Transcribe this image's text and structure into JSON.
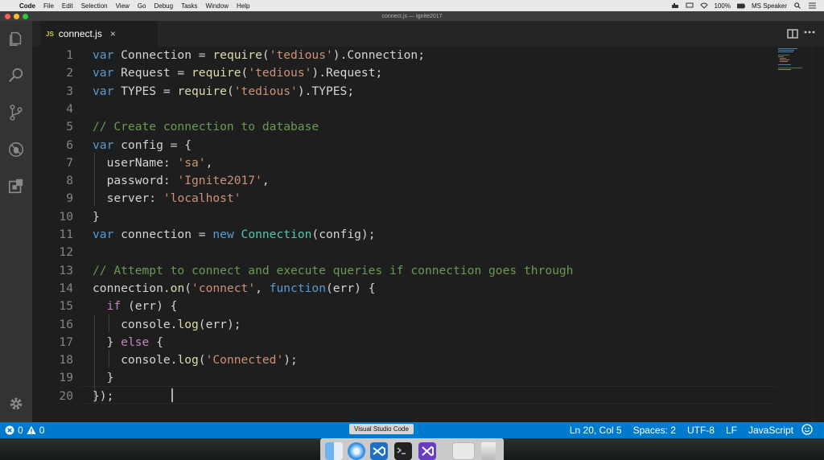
{
  "menubar": {
    "app_name": "Code",
    "items": [
      "File",
      "Edit",
      "Selection",
      "View",
      "Go",
      "Debug",
      "Tasks",
      "Window",
      "Help"
    ],
    "battery": "100%",
    "user": "MS Speaker"
  },
  "window": {
    "title": "connect.js — Ignite2017"
  },
  "tab": {
    "badge": "JS",
    "filename": "connect.js",
    "close_glyph": "×"
  },
  "editor": {
    "lines": [
      {
        "n": "1",
        "tokens": [
          [
            "kw",
            "var"
          ],
          [
            "p",
            " Connection = "
          ],
          [
            "fn",
            "require"
          ],
          [
            "p",
            "("
          ],
          [
            "str",
            "'tedious'"
          ],
          [
            "p",
            ").Connection;"
          ]
        ]
      },
      {
        "n": "2",
        "tokens": [
          [
            "kw",
            "var"
          ],
          [
            "p",
            " Request = "
          ],
          [
            "fn",
            "require"
          ],
          [
            "p",
            "("
          ],
          [
            "str",
            "'tedious'"
          ],
          [
            "p",
            ").Request;"
          ]
        ]
      },
      {
        "n": "3",
        "tokens": [
          [
            "kw",
            "var"
          ],
          [
            "p",
            " TYPES = "
          ],
          [
            "fn",
            "require"
          ],
          [
            "p",
            "("
          ],
          [
            "str",
            "'tedious'"
          ],
          [
            "p",
            ").TYPES;"
          ]
        ]
      },
      {
        "n": "4",
        "tokens": []
      },
      {
        "n": "5",
        "tokens": [
          [
            "com",
            "// Create connection to database"
          ]
        ]
      },
      {
        "n": "6",
        "tokens": [
          [
            "kw",
            "var"
          ],
          [
            "p",
            " config = {"
          ]
        ]
      },
      {
        "n": "7",
        "tokens": [
          [
            "p",
            "  userName: "
          ],
          [
            "str",
            "'sa'"
          ],
          [
            "p",
            ","
          ]
        ]
      },
      {
        "n": "8",
        "tokens": [
          [
            "p",
            "  password: "
          ],
          [
            "str",
            "'Ignite2017'"
          ],
          [
            "p",
            ","
          ]
        ]
      },
      {
        "n": "9",
        "tokens": [
          [
            "p",
            "  server: "
          ],
          [
            "str",
            "'localhost'"
          ]
        ]
      },
      {
        "n": "10",
        "tokens": [
          [
            "p",
            "}"
          ]
        ]
      },
      {
        "n": "11",
        "tokens": [
          [
            "kw",
            "var"
          ],
          [
            "p",
            " connection = "
          ],
          [
            "kw",
            "new"
          ],
          [
            "p",
            " "
          ],
          [
            "cls",
            "Connection"
          ],
          [
            "p",
            "(config);"
          ]
        ]
      },
      {
        "n": "12",
        "tokens": []
      },
      {
        "n": "13",
        "tokens": [
          [
            "com",
            "// Attempt to connect and execute queries if connection goes through"
          ]
        ]
      },
      {
        "n": "14",
        "tokens": [
          [
            "p",
            "connection."
          ],
          [
            "fn",
            "on"
          ],
          [
            "p",
            "("
          ],
          [
            "str",
            "'connect'"
          ],
          [
            "p",
            ", "
          ],
          [
            "kw",
            "function"
          ],
          [
            "p",
            "(err) {"
          ]
        ]
      },
      {
        "n": "15",
        "tokens": [
          [
            "p",
            "  "
          ],
          [
            "ctl",
            "if"
          ],
          [
            "p",
            " (err) {"
          ]
        ]
      },
      {
        "n": "16",
        "tokens": [
          [
            "p",
            "    console."
          ],
          [
            "fn",
            "log"
          ],
          [
            "p",
            "(err);"
          ]
        ]
      },
      {
        "n": "17",
        "tokens": [
          [
            "p",
            "  } "
          ],
          [
            "ctl",
            "else"
          ],
          [
            "p",
            " {"
          ]
        ]
      },
      {
        "n": "18",
        "tokens": [
          [
            "p",
            "    console."
          ],
          [
            "fn",
            "log"
          ],
          [
            "p",
            "("
          ],
          [
            "str",
            "'Connected'"
          ],
          [
            "p",
            ");"
          ]
        ]
      },
      {
        "n": "19",
        "tokens": [
          [
            "p",
            "  }"
          ]
        ]
      },
      {
        "n": "20",
        "tokens": [
          [
            "p",
            "});"
          ]
        ]
      }
    ]
  },
  "statusbar": {
    "errors": "0",
    "warnings": "0",
    "position": "Ln 20, Col 5",
    "spaces": "Spaces: 2",
    "encoding": "UTF-8",
    "eol": "LF",
    "language": "JavaScript"
  },
  "dock": {
    "tooltip": "Visual Studio Code"
  },
  "colors": {
    "accent": "#007acc",
    "editor_bg": "#1e1e1e",
    "activity_bg": "#333333"
  },
  "icons": [
    "explorer-icon",
    "search-icon",
    "source-control-icon",
    "debug-icon",
    "extensions-icon",
    "settings-gear-icon",
    "split-editor-icon",
    "more-actions-icon",
    "error-icon",
    "warning-icon",
    "feedback-smiley-icon"
  ]
}
